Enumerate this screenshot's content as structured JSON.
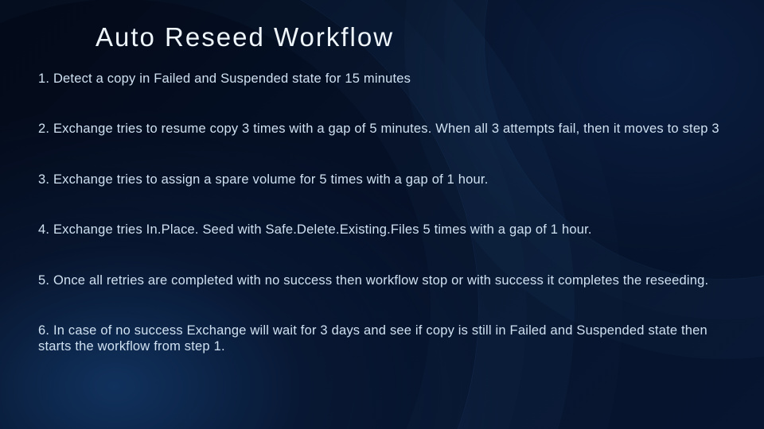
{
  "title": "Auto Reseed Workflow",
  "steps": [
    "1. Detect a copy in Failed and Suspended state for 15 minutes",
    "2. Exchange tries to resume copy 3 times with a gap of 5 minutes. When all 3 attempts fail, then it moves to step 3",
    "3. Exchange tries to assign a spare volume for 5 times with a gap of 1 hour.",
    "4. Exchange tries In.Place. Seed with Safe.Delete.Existing.Files 5 times with a gap of 1 hour.",
    "5. Once all retries are completed with no success then workflow stop or with success it completes the reseeding.",
    "6. In case of no success Exchange will wait for 3 days and see if copy is still in Failed and Suspended state then starts the workflow from step 1."
  ]
}
